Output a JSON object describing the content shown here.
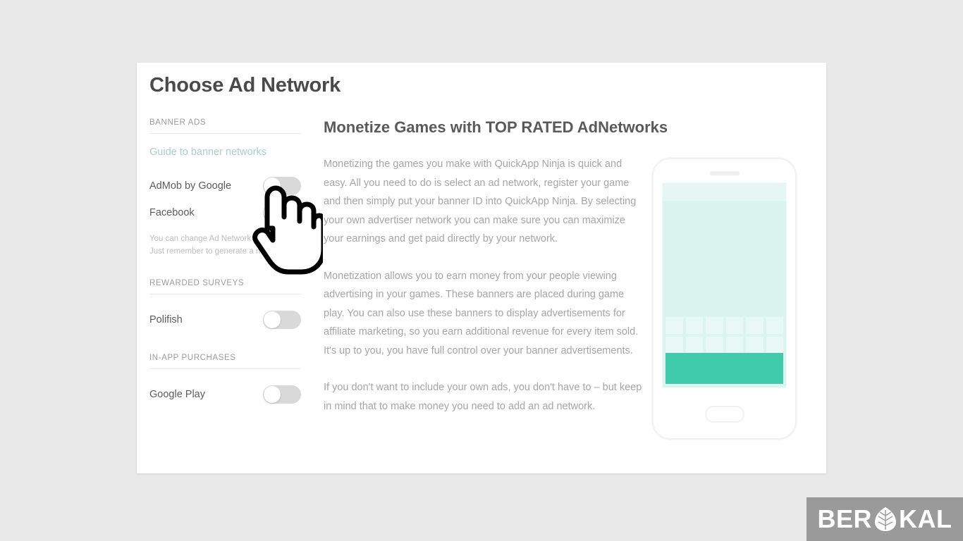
{
  "page": {
    "title": "Choose Ad Network",
    "background_color": "#e9e9e9",
    "card_background": "#ffffff"
  },
  "sidebar": {
    "sections": [
      {
        "label": "BANNER ADS",
        "link": {
          "text": "Guide to banner networks",
          "color": "#a9cfc7"
        },
        "items": [
          {
            "label": "AdMob by Google",
            "toggle": "off"
          },
          {
            "label": "Facebook",
            "toggle": "off"
          }
        ],
        "note_line1": "You can change Ad Network at",
        "note_line2": "Just remember to generate a new"
      },
      {
        "label": "REWARDED SURVEYS",
        "items": [
          {
            "label": "Polifish",
            "toggle": "off"
          }
        ]
      },
      {
        "label": "IN-APP PURCHASES",
        "items": [
          {
            "label": "Google Play",
            "toggle": "off"
          }
        ]
      }
    ]
  },
  "content": {
    "heading": "Monetize Games with TOP RATED AdNetworks",
    "paragraphs": [
      "Monetizing the games you make with QuickApp Ninja is quick and easy. All you need to do is select an ad network, register your game and then simply put your banner ID into QuickApp Ninja. By selecting your own advertiser network you can make sure you can maximize your earnings and get paid directly by your network.",
      "Monetization allows you to earn money from your people viewing advertising in your games. These banners are placed during game play. You can also use these banners to display advertisements for affiliate marketing, so you earn additional revenue for every item sold. It's up to you, you have full control over your banner advertisements.",
      "If you don't want to include your own ads, you don't have to – but keep in mind that to make money you need to add an ad network."
    ]
  },
  "phone_mockup": {
    "banner_color": "#3fcbac",
    "screen_color": "#dcf4ef",
    "key_count": 12
  },
  "cursor": {
    "type": "pointing-hand"
  },
  "watermark": {
    "text_before": "BER",
    "text_after": "KAL",
    "background_color": "#9a9a9a",
    "text_color": "#ffffff"
  }
}
